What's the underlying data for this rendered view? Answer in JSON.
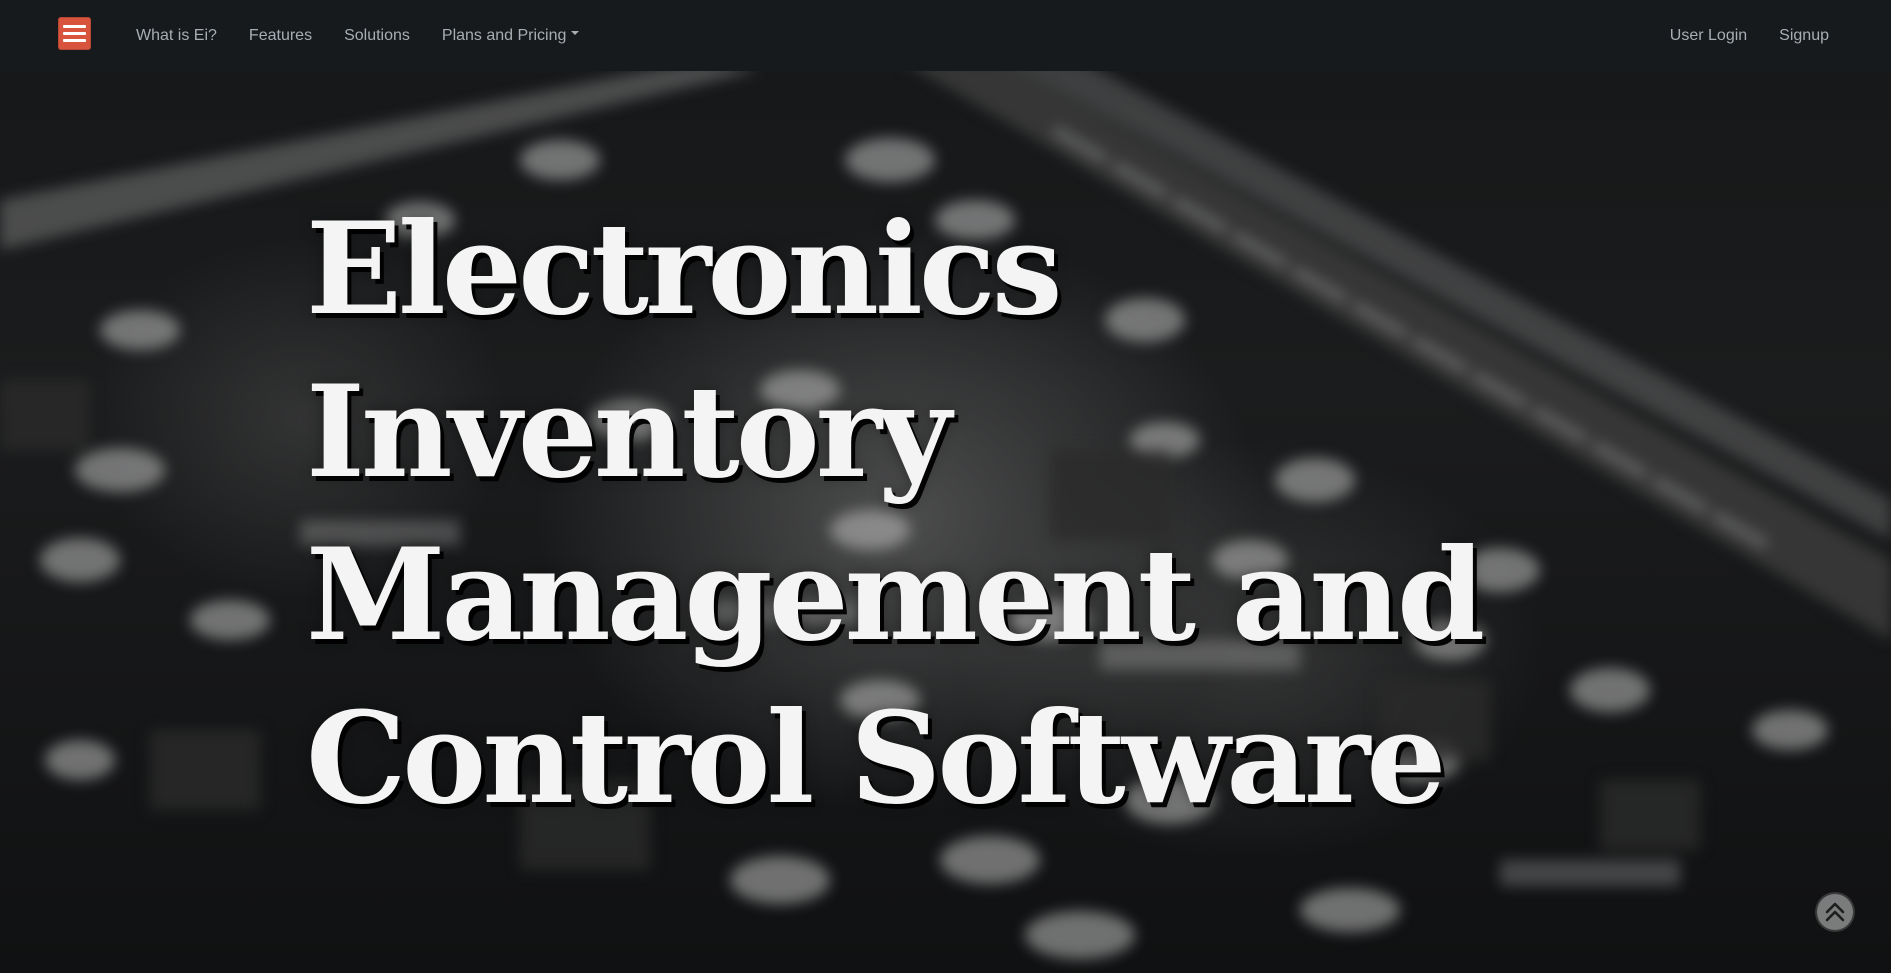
{
  "nav": {
    "menu_icon": "hamburger-menu-icon",
    "left_items": [
      {
        "label": "What is Ei?"
      },
      {
        "label": "Features"
      },
      {
        "label": "Solutions"
      },
      {
        "label": "Plans and Pricing",
        "has_dropdown": true
      }
    ],
    "right_items": [
      {
        "label": "User Login"
      },
      {
        "label": "Signup"
      }
    ]
  },
  "hero": {
    "title_lines": [
      "Electronics",
      "Inventory",
      "Management and",
      "Control Software"
    ]
  },
  "back_to_top": {
    "icon": "double-chevron-up-icon"
  },
  "colors": {
    "navbar_bg": "#161a1d",
    "menu_button": "#d8543d",
    "nav_text": "#a7adb2",
    "hero_text": "#f4f4f4"
  }
}
